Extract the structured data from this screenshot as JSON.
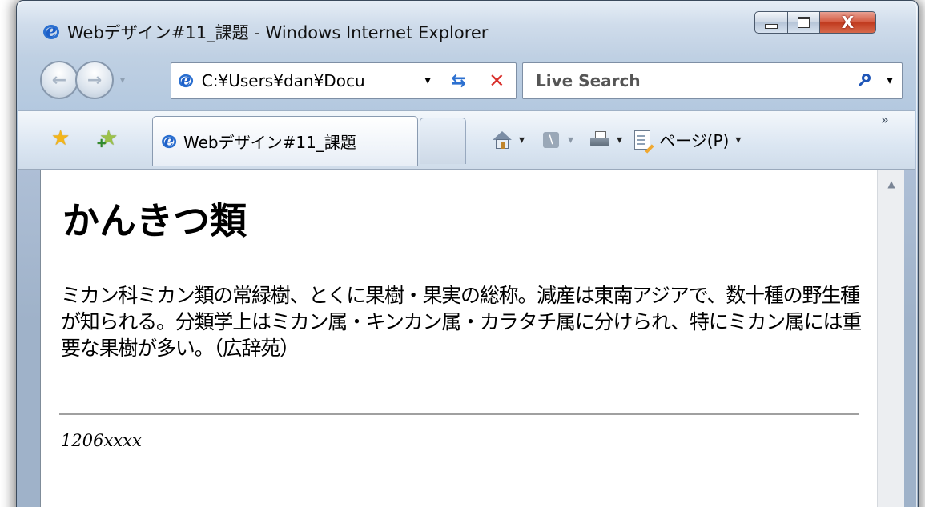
{
  "window": {
    "title": "Webデザイン#11_課題 - Windows Internet Explorer",
    "close_glyph": "X"
  },
  "nav": {
    "back_glyph": "←",
    "forward_glyph": "→",
    "dropdown_glyph": "▾"
  },
  "address_bar": {
    "value": "C:¥Users¥dan¥Docu",
    "dropdown_glyph": "▾",
    "refresh_glyph": "⇆",
    "stop_glyph": "✕"
  },
  "search": {
    "placeholder": "Live Search",
    "dropdown_glyph": "▾"
  },
  "toolbar": {
    "favorites_glyph": "★",
    "add_favorites_glyph": "★",
    "add_plus_glyph": "+",
    "tab_label": "Webデザイン#11_課題",
    "feed_glyph": "\\",
    "dropdown_glyph": "▾",
    "page_menu_label": "ページ(P)",
    "chevron_glyph": "»"
  },
  "page": {
    "heading": "かんきつ類",
    "paragraph": "ミカン科ミカン類の常緑樹、とくに果樹・果実の総称。減産は東南アジアで、数十種の野生種が知られる。分類学上はミカン属・キンカン属・カラタチ属に分けられ、特にミカン属には重要な果樹が多い。（広辞苑）",
    "footer": "1206xxxx"
  },
  "scrollbar": {
    "up_glyph": "▲"
  }
}
